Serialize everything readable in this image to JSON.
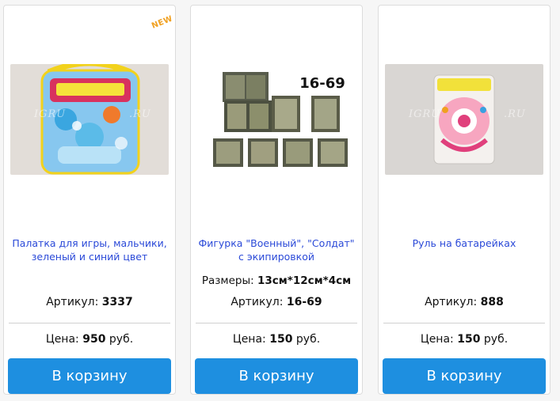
{
  "products": [
    {
      "badge": "NEW",
      "title": "Палатка для игры, мальчики, зеленый и синий цвет",
      "size_label": "",
      "size_value": "",
      "sku_label": "Артикул:",
      "sku_value": "3337",
      "price_label": "Цена:",
      "price_value": "950",
      "currency": "руб.",
      "cart_label": "В корзину",
      "image_text": "IGRU",
      "image_text2": ".RU"
    },
    {
      "title": "Фигурка \"Военный\", \"Солдат\" с экипировкой",
      "size_label": "Размеры:",
      "size_value": "13см*12см*4см",
      "sku_label": "Артикул:",
      "sku_value": "16-69",
      "price_label": "Цена:",
      "price_value": "150",
      "currency": "руб.",
      "cart_label": "В корзину",
      "image_text": "16-69"
    },
    {
      "title": "Руль на батарейках",
      "size_label": "",
      "size_value": "",
      "sku_label": "Артикул:",
      "sku_value": "888",
      "price_label": "Цена:",
      "price_value": "150",
      "currency": "руб.",
      "cart_label": "В корзину",
      "image_text": "IGRU",
      "image_text2": ".RU"
    }
  ],
  "colors": {
    "link": "#2a49d8",
    "button": "#1e8fe0",
    "badge": "#f0a020"
  }
}
